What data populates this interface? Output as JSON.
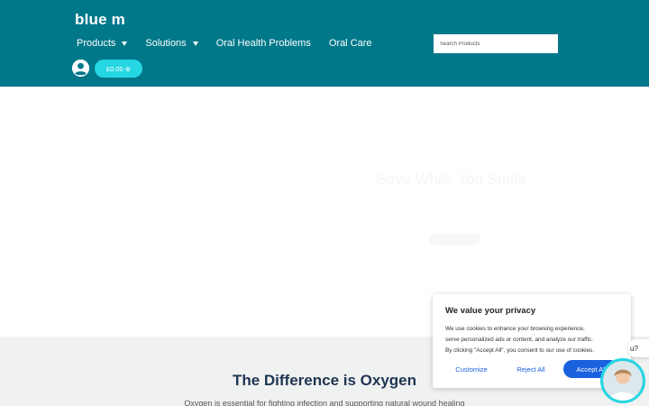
{
  "header": {
    "logo": "blue m",
    "nav": [
      {
        "label": "Products"
      },
      {
        "label": "Solutions"
      },
      {
        "label": "Oral Health Problems"
      },
      {
        "label": "Oral Care"
      }
    ],
    "search_placeholder": "Search Products",
    "cart_label": "£0.00 ⊕"
  },
  "hero": {
    "title": "Save While You Smile"
  },
  "section": {
    "title": "The Difference is Oxygen",
    "text": "Oxygen is essential for fighting infection and supporting natural wound healing"
  },
  "cookie": {
    "title": "We value your privacy",
    "lines": [
      "We use cookies to enhance your browsing experience,",
      "serve personalized ads or content, and analyze our traffic.",
      "By clicking \"Accept All\", you consent to our use of cookies."
    ],
    "customize": "Customize",
    "reject": "Reject All",
    "accept": "Accept All"
  },
  "chat": {
    "bubble": "u?"
  },
  "colors": {
    "header_bg": "#00788a",
    "cart_bg": "#25d6e3",
    "accent_blue": "#1a61e0",
    "section_bg": "#f0f1f1"
  }
}
